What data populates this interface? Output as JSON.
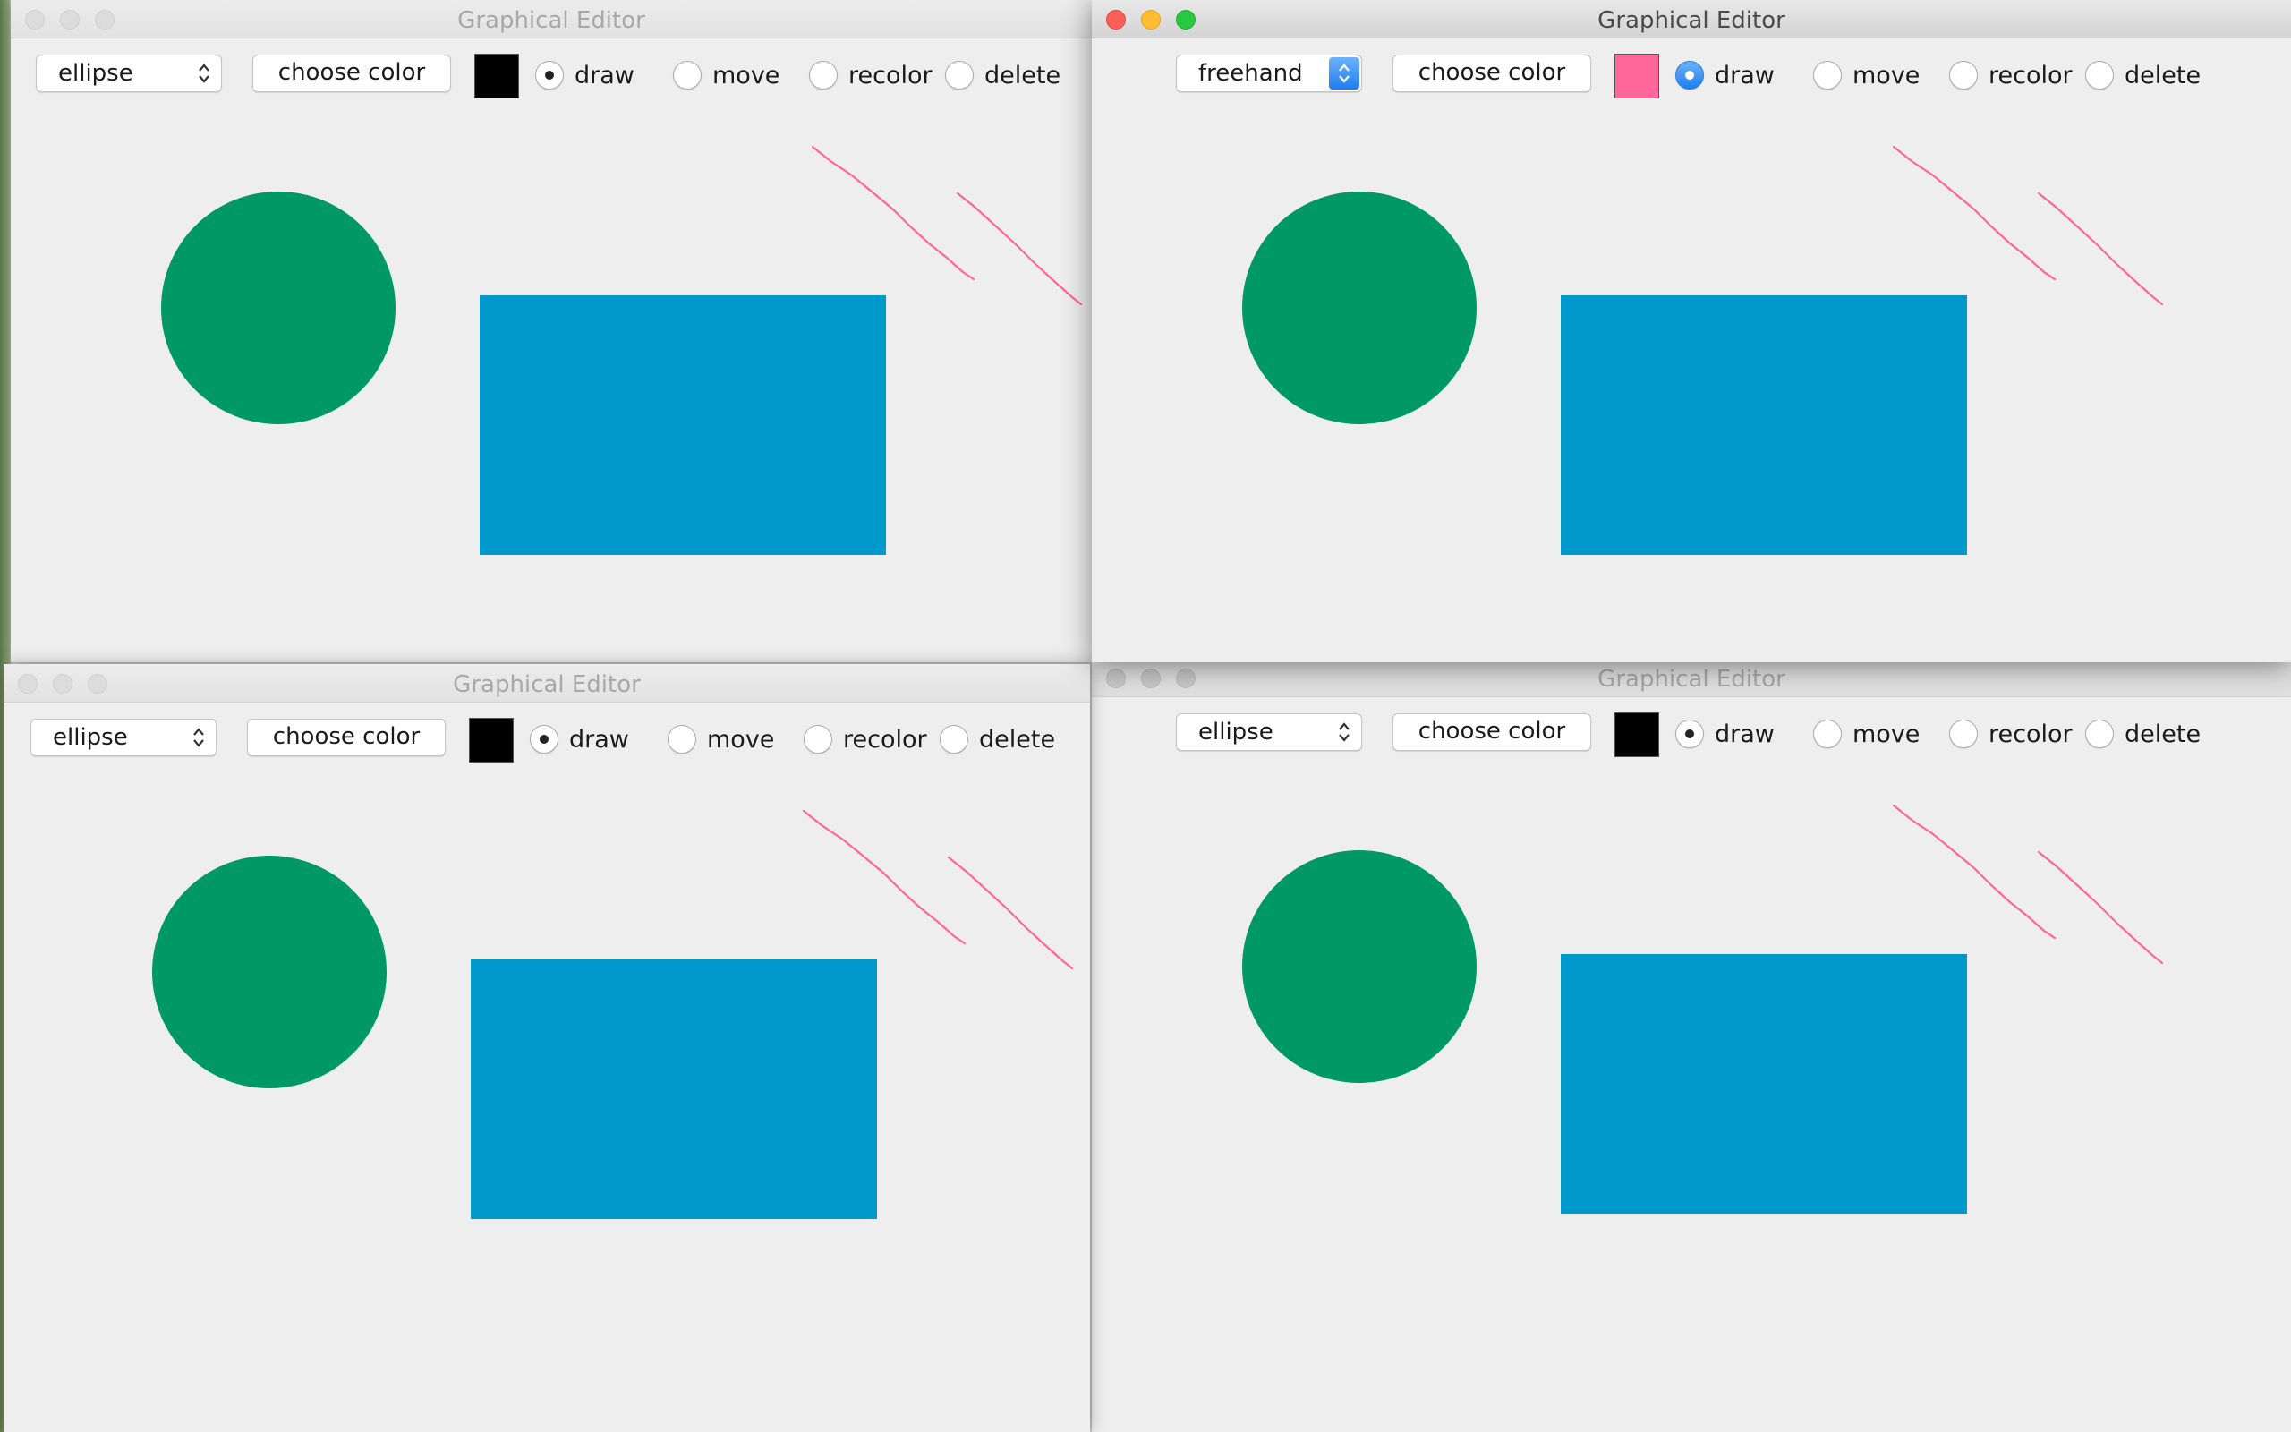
{
  "app": {
    "title": "Graphical Editor"
  },
  "toolbar_common": {
    "choose_color_label": "choose color",
    "modes": [
      "draw",
      "move",
      "recolor",
      "delete"
    ]
  },
  "colors": {
    "ellipse_fill": "#009966",
    "rectangle_fill": "#0099cc",
    "freehand_stroke": "#ff6699",
    "black": "#000000",
    "pink": "#ff6699",
    "accent_blue": "#1f7dee"
  },
  "icons": {
    "select_arrows": "chevron-up-down-icon",
    "window_close": "close-icon",
    "window_minimize": "minimize-icon",
    "window_zoom": "zoom-icon"
  },
  "windows": [
    {
      "title": "Graphical Editor",
      "shape_selected": "ellipse",
      "current_color": "#000000",
      "selected_mode": "draw",
      "focused": false
    },
    {
      "title": "Graphical Editor",
      "shape_selected": "freehand",
      "current_color": "#ff6699",
      "selected_mode": "draw",
      "focused": true
    },
    {
      "title": "Graphical Editor",
      "shape_selected": "ellipse",
      "current_color": "#000000",
      "selected_mode": "draw",
      "focused": false
    },
    {
      "title": "Graphical Editor",
      "shape_selected": "ellipse",
      "current_color": "#000000",
      "selected_mode": "draw",
      "focused": false
    }
  ]
}
